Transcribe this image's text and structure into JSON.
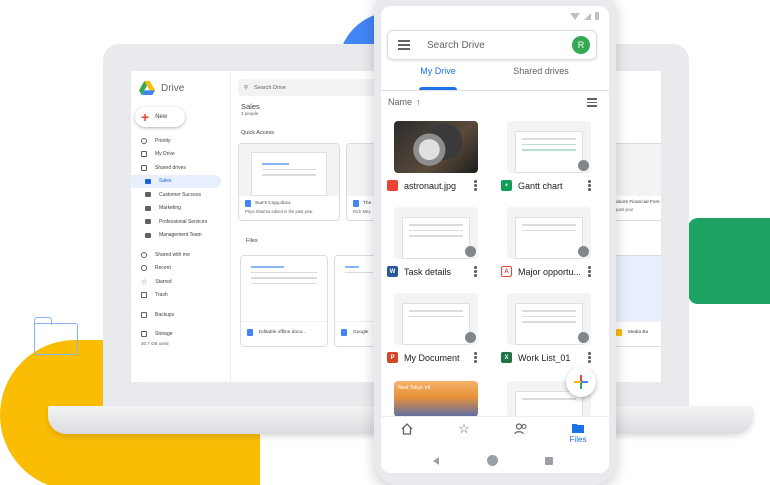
{
  "desktop": {
    "app_name": "Drive",
    "new_label": "New",
    "search_placeholder": "Search Drive",
    "nav": {
      "priority": "Priority",
      "my_drive": "My Drive",
      "shared_drives": "Shared drives",
      "sales": "Sales",
      "customer_success": "Customer Success",
      "marketing": "Marketing",
      "professional_services": "Professional Services",
      "management_team": "Management Team",
      "shared_with_me": "Shared with me",
      "recent": "Recent",
      "starred": "Starred",
      "trash": "Trash",
      "backups": "Backups",
      "storage": "Storage",
      "storage_used": "30.7 GB used"
    },
    "folder_title": "Sales",
    "folder_subtitle": "3 people",
    "quick_access_label": "Quick Access",
    "quick_access": [
      {
        "name": "Sue's Copy.docx",
        "detail": "Priya Sharma edited in the past year"
      },
      {
        "name": "The",
        "detail": "Rich Mey"
      }
    ],
    "right_card": {
      "name": "doors Financial Fore",
      "detail": "past year"
    },
    "files_label": "Files",
    "files": [
      {
        "name": "Editable offline docu..."
      },
      {
        "name": "Google"
      }
    ],
    "right_file": {
      "name": "Media Bu"
    }
  },
  "mobile": {
    "search_placeholder": "Search Drive",
    "avatar_initial": "R",
    "tabs": [
      "My Drive",
      "Shared drives"
    ],
    "sort_label": "Name",
    "sort_arrow": "↑",
    "files": [
      {
        "name": "astronaut.jpg",
        "type": "image",
        "color": "#ea4335"
      },
      {
        "name": "Gantt chart",
        "type": "sheet",
        "color": "#0f9d58"
      },
      {
        "name": "Task details",
        "type": "word",
        "color": "#2b579a"
      },
      {
        "name": "Major opportu...",
        "type": "pdf",
        "color": "#ea4335"
      },
      {
        "name": "My Document",
        "type": "powerpoint",
        "color": "#d24726"
      },
      {
        "name": "Work List_01",
        "type": "excel",
        "color": "#217346"
      }
    ],
    "photo_caption": "Next Tokyo 'ell",
    "bottom_nav": {
      "files": "Files"
    },
    "brand_colors": {
      "blue": "#4285f4",
      "red": "#ea4335",
      "yellow": "#fbbc04",
      "green": "#34a853"
    }
  }
}
